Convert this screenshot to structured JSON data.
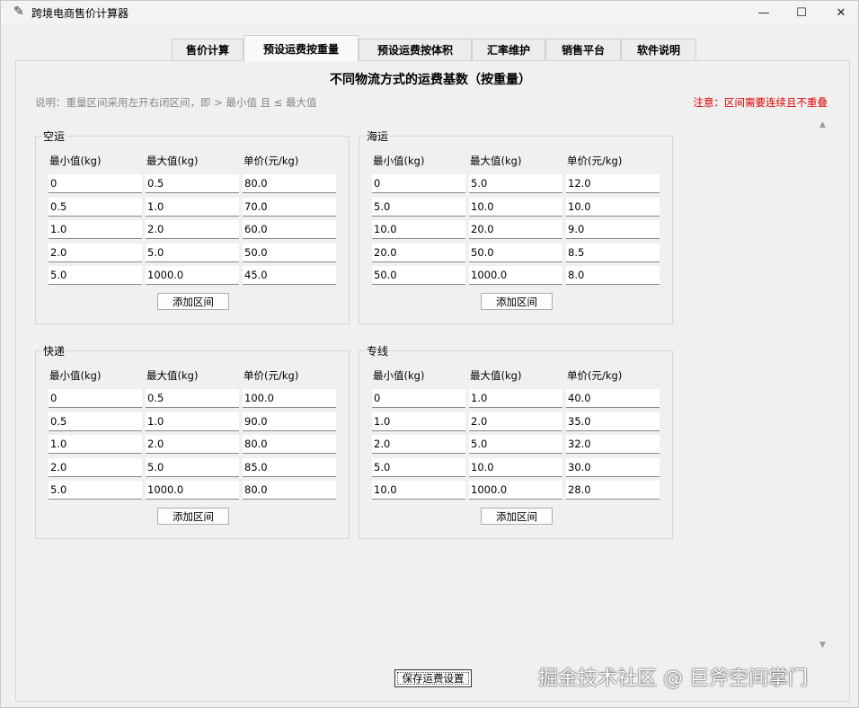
{
  "window": {
    "title": "跨境电商售价计算器",
    "minimize_icon": "minimize-icon",
    "maximize_icon": "maximize-icon",
    "close_icon": "close-icon"
  },
  "tabs": [
    {
      "label": "售价计算"
    },
    {
      "label": "预设运费按重量"
    },
    {
      "label": "预设运费按体积"
    },
    {
      "label": "汇率维护"
    },
    {
      "label": "销售平台"
    },
    {
      "label": "软件说明"
    }
  ],
  "active_tab": "预设运费按重量",
  "heading": "不同物流方式的运费基数（按重量）",
  "description": "说明：重量区间采用左开右闭区间，即 > 最小值 且 ≤ 最大值",
  "warning": "注意：区间需要连续且不重叠",
  "warning_color": "#e00000",
  "column_headers": [
    "最小值(kg)",
    "最大值(kg)",
    "单价(元/kg)"
  ],
  "add_label": "添加区间",
  "groups": [
    {
      "title": "空运",
      "rows": [
        [
          "0",
          "0.5",
          "80.0"
        ],
        [
          "0.5",
          "1.0",
          "70.0"
        ],
        [
          "1.0",
          "2.0",
          "60.0"
        ],
        [
          "2.0",
          "5.0",
          "50.0"
        ],
        [
          "5.0",
          "1000.0",
          "45.0"
        ]
      ]
    },
    {
      "title": "海运",
      "rows": [
        [
          "0",
          "5.0",
          "12.0"
        ],
        [
          "5.0",
          "10.0",
          "10.0"
        ],
        [
          "10.0",
          "20.0",
          "9.0"
        ],
        [
          "20.0",
          "50.0",
          "8.5"
        ],
        [
          "50.0",
          "1000.0",
          "8.0"
        ]
      ]
    },
    {
      "title": "快递",
      "rows": [
        [
          "0",
          "0.5",
          "100.0"
        ],
        [
          "0.5",
          "1.0",
          "90.0"
        ],
        [
          "1.0",
          "2.0",
          "80.0"
        ],
        [
          "2.0",
          "5.0",
          "85.0"
        ],
        [
          "5.0",
          "1000.0",
          "80.0"
        ]
      ]
    },
    {
      "title": "专线",
      "rows": [
        [
          "0",
          "1.0",
          "40.0"
        ],
        [
          "1.0",
          "2.0",
          "35.0"
        ],
        [
          "2.0",
          "5.0",
          "32.0"
        ],
        [
          "5.0",
          "10.0",
          "30.0"
        ],
        [
          "10.0",
          "1000.0",
          "28.0"
        ]
      ]
    }
  ],
  "save_label": "保存运费设置",
  "watermark": "掘金技术社区 @ 巨斧空间掌门"
}
